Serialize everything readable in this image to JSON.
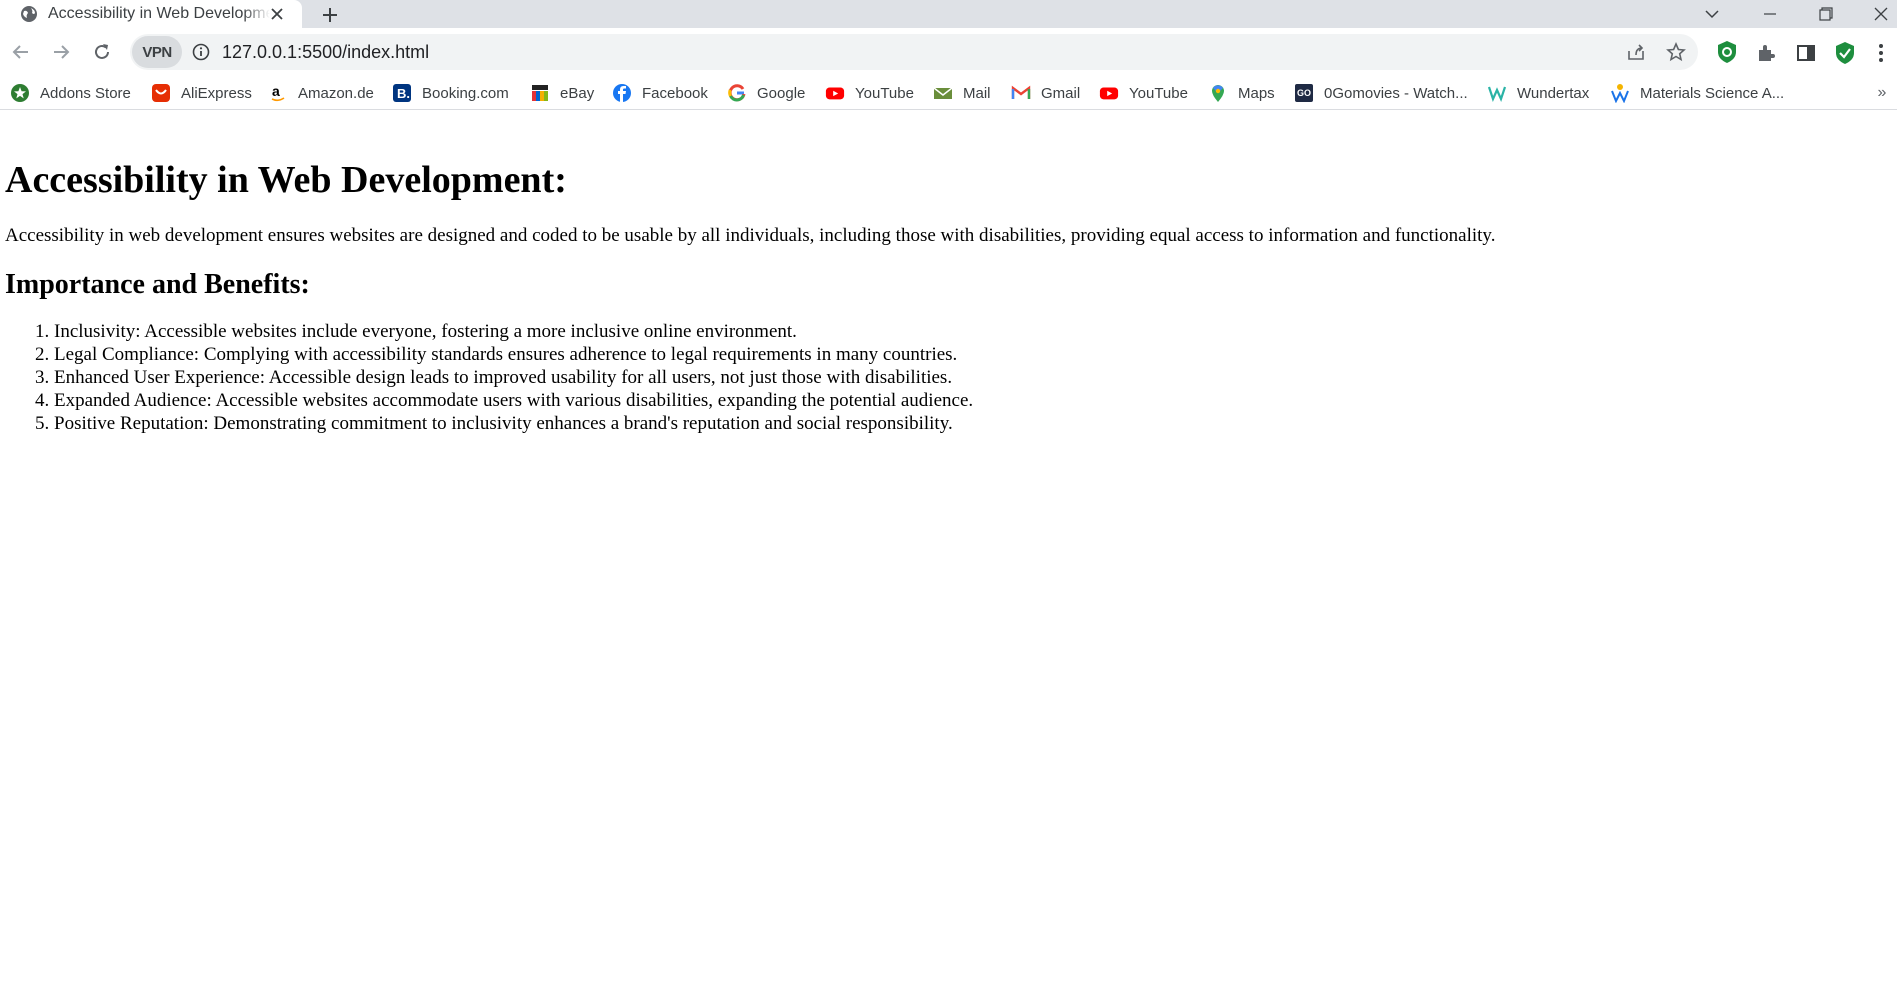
{
  "browser": {
    "tab": {
      "title": "Accessibility in Web Development",
      "favicon": "globe-icon"
    },
    "new_tab_icon": "plus-icon",
    "window_controls": [
      "chevron-down-icon",
      "minimize-icon",
      "restore-icon",
      "close-icon"
    ],
    "address_bar": {
      "vpn_label": "VPN",
      "url": "127.0.0.1:5500/index.html"
    },
    "toolbar_icons": [
      "back-icon",
      "forward-icon",
      "reload-icon",
      "share-icon",
      "star-icon",
      "adblock-icon",
      "extensions-icon",
      "side-panel-icon",
      "shield-check-icon",
      "menu-icon"
    ]
  },
  "bookmarks": [
    {
      "label": "Addons Store",
      "icon": "addons-store-icon",
      "color": "#2e7d32"
    },
    {
      "label": "AliExpress",
      "icon": "aliexpress-icon",
      "color": "#e62e04"
    },
    {
      "label": "Amazon.de",
      "icon": "amazon-icon",
      "color": "#000000"
    },
    {
      "label": "Booking.com",
      "icon": "booking-icon",
      "color": "#003580"
    },
    {
      "label": "eBay",
      "icon": "ebay-icon",
      "color": "#e53238"
    },
    {
      "label": "Facebook",
      "icon": "facebook-icon",
      "color": "#1877f2"
    },
    {
      "label": "Google",
      "icon": "google-icon",
      "color": "#4285f4"
    },
    {
      "label": "YouTube",
      "icon": "youtube-icon",
      "color": "#ff0000"
    },
    {
      "label": "Mail",
      "icon": "mail-icon",
      "color": "#6a8e3b"
    },
    {
      "label": "Gmail",
      "icon": "gmail-icon",
      "color": "#ea4335"
    },
    {
      "label": "YouTube",
      "icon": "youtube-icon",
      "color": "#ff0000"
    },
    {
      "label": "Maps",
      "icon": "maps-icon",
      "color": "#34a853"
    },
    {
      "label": "0Gomovies - Watch...",
      "icon": "gomovies-icon",
      "color": "#1f2a44"
    },
    {
      "label": "Wundertax",
      "icon": "wundertax-icon",
      "color": "#2ab3a6"
    },
    {
      "label": "Materials Science A...",
      "icon": "materials-science-icon",
      "color": "#f4b400"
    }
  ],
  "bookmarks_more": "»",
  "page": {
    "heading": "Accessibility in Web Development:",
    "intro": "Accessibility in web development ensures websites are designed and coded to be usable by all individuals, including those with disabilities, providing equal access to information and functionality.",
    "subheading": "Importance and Benefits:",
    "benefits": [
      "Inclusivity: Accessible websites include everyone, fostering a more inclusive online environment.",
      "Legal Compliance: Complying with accessibility standards ensures adherence to legal requirements in many countries.",
      "Enhanced User Experience: Accessible design leads to improved usability for all users, not just those with disabilities.",
      "Expanded Audience: Accessible websites accommodate users with various disabilities, expanding the potential audience.",
      "Positive Reputation: Demonstrating commitment to inclusivity enhances a brand's reputation and social responsibility."
    ]
  }
}
